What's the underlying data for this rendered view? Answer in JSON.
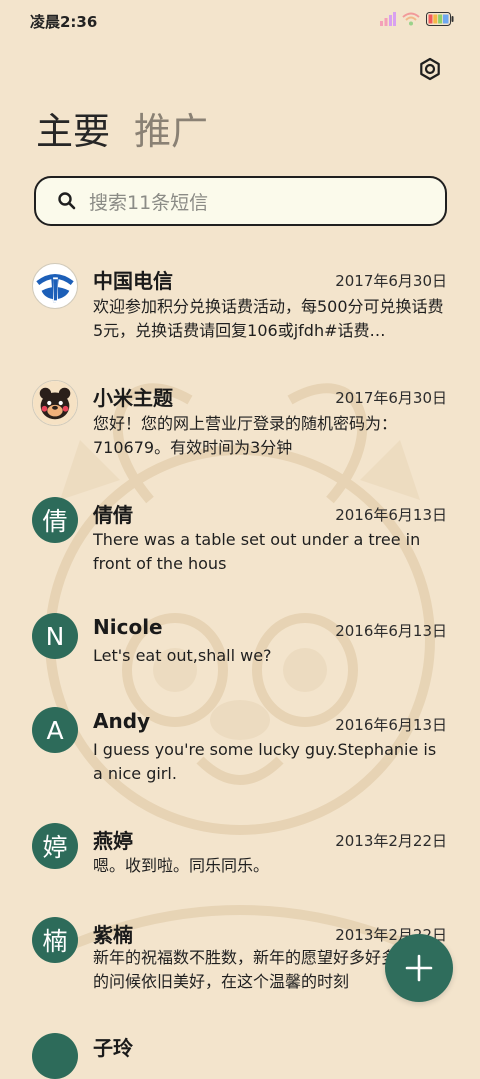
{
  "status_bar": {
    "time": "凌晨2:36"
  },
  "header": {
    "settings_icon": "gear-icon"
  },
  "tabs": [
    {
      "label": "主要",
      "active": true
    },
    {
      "label": "推广",
      "active": false
    }
  ],
  "search": {
    "placeholder": "搜索11条短信"
  },
  "messages": [
    {
      "name": "中国电信",
      "date": "2017年6月30日",
      "preview": "欢迎参加积分兑换话费活动，每500分可兑换话费5元，兑换话费请回复106或jfdh#话费…",
      "avatar": "china-telecom-logo"
    },
    {
      "name": "小米主题",
      "date": "2017年6月30日",
      "preview": "您好！您的网上营业厅登录的随机密码为：710679。有效时间为3分钟",
      "avatar": "bear-avatar"
    },
    {
      "name": "倩倩",
      "date": "2016年6月13日",
      "preview": "There was a table set out under a tree in front of the hous",
      "avatar_letter": "倩"
    },
    {
      "name": "Nicole",
      "date": "2016年6月13日",
      "preview": "Let's eat out,shall we?",
      "avatar_letter": "N"
    },
    {
      "name": "Andy",
      "date": "2016年6月13日",
      "preview": "I guess you're some lucky guy.Stephanie is a nice girl.",
      "avatar_letter": "A"
    },
    {
      "name": "燕婷",
      "date": "2013年2月22日",
      "preview": "嗯。收到啦。同乐同乐。",
      "avatar_letter": "婷"
    },
    {
      "name": "紫楠",
      "date": "2013年2月22日",
      "preview": "新年的祝福数不胜数，新年的愿望好多好多，新年的问候依旧美好，在这个温馨的时刻",
      "avatar_letter": "楠"
    },
    {
      "name": "子玲",
      "date": "",
      "preview": "",
      "avatar_letter": ""
    }
  ],
  "fab": {
    "icon": "plus-icon"
  }
}
